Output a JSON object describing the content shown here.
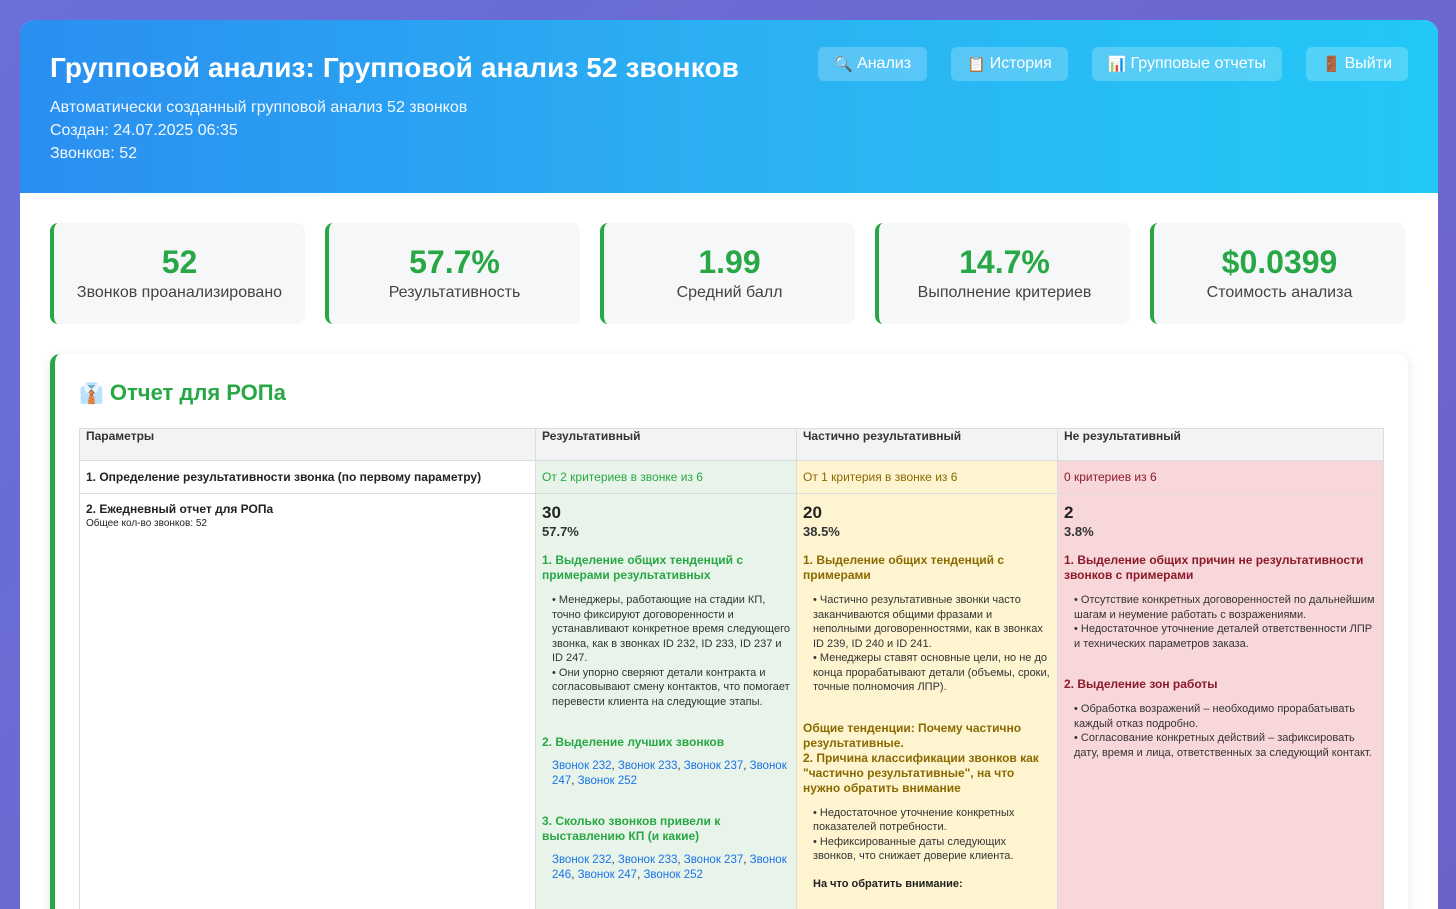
{
  "header": {
    "title": "Групповой анализ: Групповой анализ 52 звонков",
    "description": "Автоматически созданный групповой анализ 52 звонков",
    "created": "Создан: 24.07.2025 06:35",
    "calls": "Звонков: 52"
  },
  "nav": {
    "analysis": {
      "icon": "magnifier-icon",
      "glyph": "🔍",
      "label": "Анализ"
    },
    "history": {
      "icon": "clipboard-icon",
      "glyph": "📋",
      "label": "История"
    },
    "reports": {
      "icon": "bar-chart-icon",
      "glyph": "📊",
      "label": "Групповые отчеты"
    },
    "logout": {
      "icon": "door-icon",
      "glyph": "🚪",
      "label": "Выйти"
    }
  },
  "stats": [
    {
      "value": "52",
      "label": "Звонков проанализировано"
    },
    {
      "value": "57.7%",
      "label": "Результативность"
    },
    {
      "value": "1.99",
      "label": "Средний балл"
    },
    {
      "value": "14.7%",
      "label": "Выполнение критериев"
    },
    {
      "value": "$0.0399",
      "label": "Стоимость анализа"
    }
  ],
  "colors": {
    "accent_green": "#28a745",
    "header_blue": "#2bb3f3",
    "link_blue": "#1a73e8"
  },
  "report": {
    "icon": "necktie-icon",
    "glyph": "👔",
    "title": "Отчет для РОПа",
    "columns": [
      "Параметры",
      "Результативный",
      "Частично результативный",
      "Не результативный"
    ],
    "row1": {
      "param": "1. Определение результативности звонка (по первому параметру)",
      "res": "От 2 критериев в звонке из 6",
      "part": "От 1 критерия в звонке из 6",
      "no": "0 критериев из 6"
    },
    "row2": {
      "param": "2. Ежедневный отчет для РОПа",
      "param_sub": "Общее кол-во звонков: 52",
      "res": {
        "count": "30",
        "pct": "57.7%",
        "sec1": "1. Выделение общих тенденций с примерами результативных",
        "sec1_items": [
          "Менеджеры, работающие на стадии КП, точно фиксируют договоренности и устанавливают конкретное время следующего звонка, как в звонках ID 232, ID 233, ID 237 и ID 247.",
          "Они упорно сверяют детали контракта и согласовывают смену контактов, что помогает перевести клиента на следующие этапы."
        ],
        "sec2": "2. Выделение лучших звонков",
        "sec2_links": [
          "Звонок 232",
          "Звонок 233",
          "Звонок 237",
          "Звонок 247",
          "Звонок 252"
        ],
        "sec3": "3. Сколько звонков привели к выставлению КП (и какие)",
        "sec3_links": [
          "Звонок 232",
          "Звонок 233",
          "Звонок 237",
          "Звонок 246",
          "Звонок 247",
          "Звонок 252"
        ]
      },
      "part": {
        "count": "20",
        "pct": "38.5%",
        "sec1": "1. Выделение общих тенденций с примерами",
        "sec1_items": [
          "Частично результативные звонки часто заканчиваются общими фразами и неполными договоренностями, как в звонках ID 239, ID 240 и ID 241.",
          "Менеджеры ставят основные цели, но не до конца прорабатывают детали (объемы, сроки, точные полномочия ЛПР)."
        ],
        "sec2": "Общие тенденции: Почему частично результативные.",
        "sec3": "2. Причина классификации звонков как \"частично результативные\", на что нужно обратить внимание",
        "sec3_items": [
          "Недостаточное уточнение конкретных показателей потребности.",
          "Нефиксированные даты следующих звонков, что снижает доверие клиента."
        ],
        "attention": "На что обратить внимание:"
      },
      "no": {
        "count": "2",
        "pct": "3.8%",
        "sec1": "1. Выделение общих причин не результативности звонков с примерами",
        "sec1_items": [
          "Отсутствие конкретных договоренностей по дальнейшим шагам и неумение работать с возражениями.",
          "Недостаточное уточнение деталей ответственности ЛПР и технических параметров заказа."
        ],
        "sec2": "2. Выделение зон работы",
        "sec2_items": [
          "Обработка возражений – необходимо прорабатывать каждый отказ подробно.",
          "Согласование конкретных действий – зафиксировать дату, время и лица, ответственных за следующий контакт."
        ]
      }
    }
  }
}
